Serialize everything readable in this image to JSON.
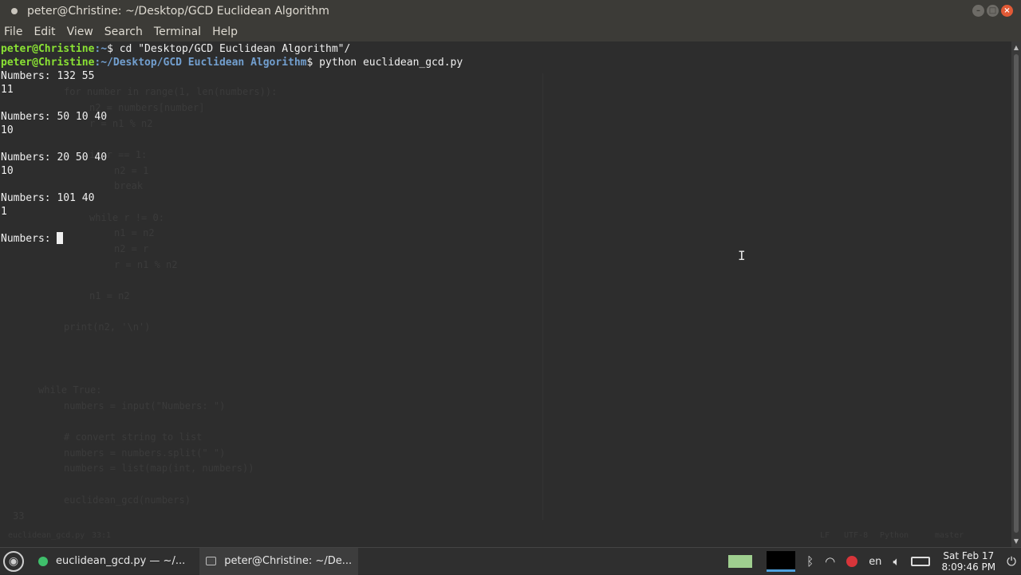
{
  "window": {
    "title": "peter@Christine: ~/Desktop/GCD Euclidean Algorithm"
  },
  "menu": {
    "file": "File",
    "edit": "Edit",
    "view": "View",
    "search": "Search",
    "terminal": "Terminal",
    "help": "Help"
  },
  "terminal": {
    "line1": {
      "user": "peter@Christine",
      "path": ":~",
      "cmd": "$ cd \"Desktop/GCD Euclidean Algorithm\"/"
    },
    "line2": {
      "user": "peter@Christine",
      "path": ":~/Desktop/GCD Euclidean Algorithm",
      "cmd": "$ python euclidean_gcd.py"
    },
    "output": [
      "Numbers: 132 55",
      "11",
      "",
      "Numbers: 50 10 40",
      "10",
      "",
      "Numbers: 20 50 40",
      "10",
      "",
      "Numbers: 101 40",
      "1",
      ""
    ],
    "current_prompt": "Numbers: "
  },
  "ghost_editor": {
    "lines": [
      "for number in range(1, len(numbers)):",
      "n2 = numbers[number]",
      "r = n1 % n2",
      "if r == 1:",
      "n2 = 1",
      "break",
      "while r != 0:",
      "n1 = n2",
      "n2 = r",
      "r = n1 % n2",
      "n1 = n2",
      "print(n2, '\\n')",
      "while True:",
      "numbers = input(\"Numbers: \")",
      "# convert string to list",
      "numbers = numbers.split(\" \")",
      "numbers = list(map(int, numbers))",
      "euclidean_gcd(numbers)",
      "33",
      "euclidean_gcd.py",
      "33:1",
      "LF",
      "UTF-8",
      "Python",
      "master"
    ]
  },
  "taskbar": {
    "tasks": [
      {
        "label": "euclidean_gcd.py — ~/..."
      },
      {
        "label": "peter@Christine: ~/De..."
      }
    ],
    "keyboard_layout": "en",
    "clock_day": "Sat Feb 17",
    "clock_time": "8:09:46 PM"
  },
  "colors": {
    "prompt_user": "#8ae234",
    "prompt_path": "#729fcf",
    "background": "#2d2d2d"
  }
}
